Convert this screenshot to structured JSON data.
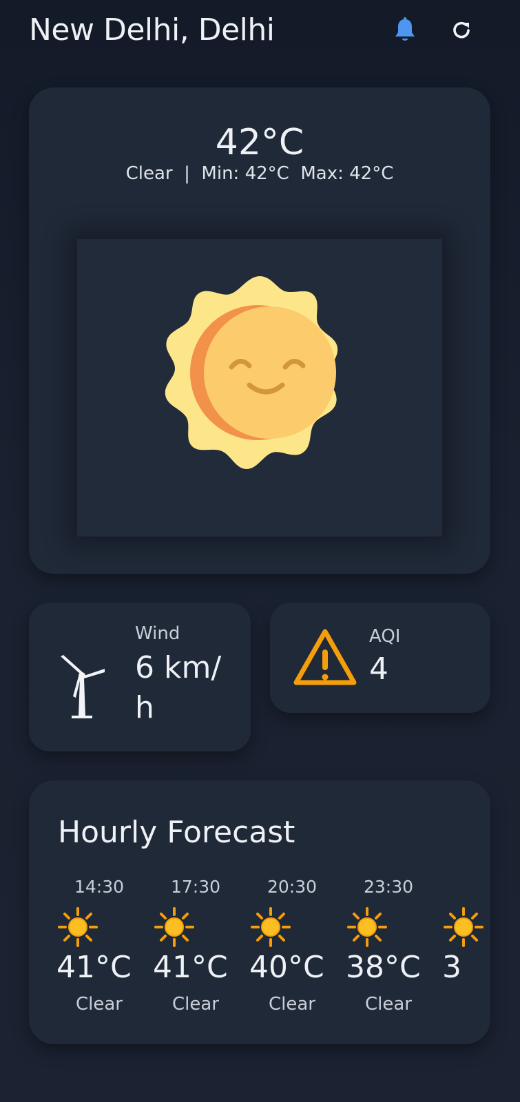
{
  "header": {
    "city": "New Delhi, Delhi",
    "bell_icon": "bell-icon",
    "refresh_icon": "refresh-icon",
    "bell_color": "#4f96f0"
  },
  "current": {
    "temperature": "42°C",
    "summary": "Clear  |  Min: 42°C  Max: 42°C",
    "illustration": "smiling-sun"
  },
  "wind": {
    "label": "Wind",
    "value": "6 km/\nh",
    "icon": "wind-turbine-icon"
  },
  "aqi": {
    "label": "AQI",
    "value": "4",
    "icon": "warning-icon",
    "icon_color": "#f59e0b"
  },
  "hourly": {
    "title": "Hourly Forecast",
    "items": [
      {
        "time": "14:30",
        "temp": "41°C",
        "desc": "Clear",
        "icon": "sun-icon"
      },
      {
        "time": "17:30",
        "temp": "41°C",
        "desc": "Clear",
        "icon": "sun-icon"
      },
      {
        "time": "20:30",
        "temp": "40°C",
        "desc": "Clear",
        "icon": "sun-icon"
      },
      {
        "time": "23:30",
        "temp": "38°C",
        "desc": "Clear",
        "icon": "sun-icon"
      },
      {
        "time": "",
        "temp": "3",
        "desc": "",
        "icon": "sun-icon"
      }
    ]
  }
}
